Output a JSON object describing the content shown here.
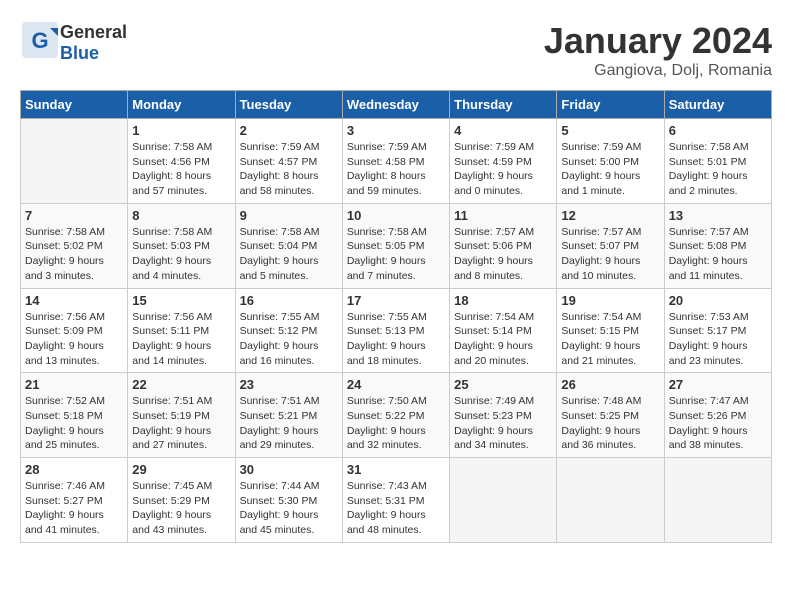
{
  "header": {
    "logo_general": "General",
    "logo_blue": "Blue",
    "month_title": "January 2024",
    "location": "Gangiova, Dolj, Romania"
  },
  "calendar": {
    "headers": [
      "Sunday",
      "Monday",
      "Tuesday",
      "Wednesday",
      "Thursday",
      "Friday",
      "Saturday"
    ],
    "weeks": [
      [
        {
          "day": "",
          "info": ""
        },
        {
          "day": "1",
          "info": "Sunrise: 7:58 AM\nSunset: 4:56 PM\nDaylight: 8 hours\nand 57 minutes."
        },
        {
          "day": "2",
          "info": "Sunrise: 7:59 AM\nSunset: 4:57 PM\nDaylight: 8 hours\nand 58 minutes."
        },
        {
          "day": "3",
          "info": "Sunrise: 7:59 AM\nSunset: 4:58 PM\nDaylight: 8 hours\nand 59 minutes."
        },
        {
          "day": "4",
          "info": "Sunrise: 7:59 AM\nSunset: 4:59 PM\nDaylight: 9 hours\nand 0 minutes."
        },
        {
          "day": "5",
          "info": "Sunrise: 7:59 AM\nSunset: 5:00 PM\nDaylight: 9 hours\nand 1 minute."
        },
        {
          "day": "6",
          "info": "Sunrise: 7:58 AM\nSunset: 5:01 PM\nDaylight: 9 hours\nand 2 minutes."
        }
      ],
      [
        {
          "day": "7",
          "info": "Sunrise: 7:58 AM\nSunset: 5:02 PM\nDaylight: 9 hours\nand 3 minutes."
        },
        {
          "day": "8",
          "info": "Sunrise: 7:58 AM\nSunset: 5:03 PM\nDaylight: 9 hours\nand 4 minutes."
        },
        {
          "day": "9",
          "info": "Sunrise: 7:58 AM\nSunset: 5:04 PM\nDaylight: 9 hours\nand 5 minutes."
        },
        {
          "day": "10",
          "info": "Sunrise: 7:58 AM\nSunset: 5:05 PM\nDaylight: 9 hours\nand 7 minutes."
        },
        {
          "day": "11",
          "info": "Sunrise: 7:57 AM\nSunset: 5:06 PM\nDaylight: 9 hours\nand 8 minutes."
        },
        {
          "day": "12",
          "info": "Sunrise: 7:57 AM\nSunset: 5:07 PM\nDaylight: 9 hours\nand 10 minutes."
        },
        {
          "day": "13",
          "info": "Sunrise: 7:57 AM\nSunset: 5:08 PM\nDaylight: 9 hours\nand 11 minutes."
        }
      ],
      [
        {
          "day": "14",
          "info": "Sunrise: 7:56 AM\nSunset: 5:09 PM\nDaylight: 9 hours\nand 13 minutes."
        },
        {
          "day": "15",
          "info": "Sunrise: 7:56 AM\nSunset: 5:11 PM\nDaylight: 9 hours\nand 14 minutes."
        },
        {
          "day": "16",
          "info": "Sunrise: 7:55 AM\nSunset: 5:12 PM\nDaylight: 9 hours\nand 16 minutes."
        },
        {
          "day": "17",
          "info": "Sunrise: 7:55 AM\nSunset: 5:13 PM\nDaylight: 9 hours\nand 18 minutes."
        },
        {
          "day": "18",
          "info": "Sunrise: 7:54 AM\nSunset: 5:14 PM\nDaylight: 9 hours\nand 20 minutes."
        },
        {
          "day": "19",
          "info": "Sunrise: 7:54 AM\nSunset: 5:15 PM\nDaylight: 9 hours\nand 21 minutes."
        },
        {
          "day": "20",
          "info": "Sunrise: 7:53 AM\nSunset: 5:17 PM\nDaylight: 9 hours\nand 23 minutes."
        }
      ],
      [
        {
          "day": "21",
          "info": "Sunrise: 7:52 AM\nSunset: 5:18 PM\nDaylight: 9 hours\nand 25 minutes."
        },
        {
          "day": "22",
          "info": "Sunrise: 7:51 AM\nSunset: 5:19 PM\nDaylight: 9 hours\nand 27 minutes."
        },
        {
          "day": "23",
          "info": "Sunrise: 7:51 AM\nSunset: 5:21 PM\nDaylight: 9 hours\nand 29 minutes."
        },
        {
          "day": "24",
          "info": "Sunrise: 7:50 AM\nSunset: 5:22 PM\nDaylight: 9 hours\nand 32 minutes."
        },
        {
          "day": "25",
          "info": "Sunrise: 7:49 AM\nSunset: 5:23 PM\nDaylight: 9 hours\nand 34 minutes."
        },
        {
          "day": "26",
          "info": "Sunrise: 7:48 AM\nSunset: 5:25 PM\nDaylight: 9 hours\nand 36 minutes."
        },
        {
          "day": "27",
          "info": "Sunrise: 7:47 AM\nSunset: 5:26 PM\nDaylight: 9 hours\nand 38 minutes."
        }
      ],
      [
        {
          "day": "28",
          "info": "Sunrise: 7:46 AM\nSunset: 5:27 PM\nDaylight: 9 hours\nand 41 minutes."
        },
        {
          "day": "29",
          "info": "Sunrise: 7:45 AM\nSunset: 5:29 PM\nDaylight: 9 hours\nand 43 minutes."
        },
        {
          "day": "30",
          "info": "Sunrise: 7:44 AM\nSunset: 5:30 PM\nDaylight: 9 hours\nand 45 minutes."
        },
        {
          "day": "31",
          "info": "Sunrise: 7:43 AM\nSunset: 5:31 PM\nDaylight: 9 hours\nand 48 minutes."
        },
        {
          "day": "",
          "info": ""
        },
        {
          "day": "",
          "info": ""
        },
        {
          "day": "",
          "info": ""
        }
      ]
    ]
  }
}
